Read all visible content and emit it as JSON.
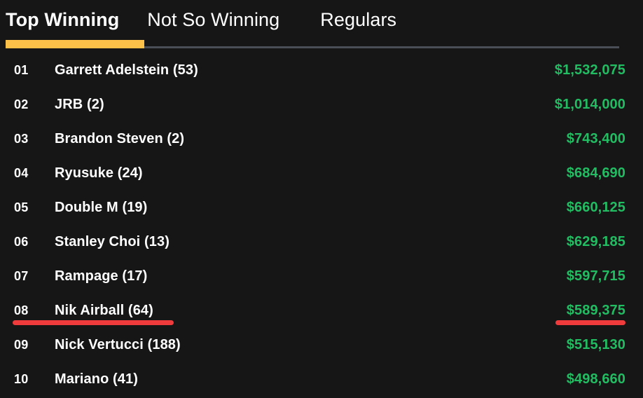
{
  "colors": {
    "background": "#161616",
    "accent_yellow": "#fcc148",
    "amount_green": "#22bd63",
    "annotation_red": "#ef3b3b",
    "track_gray": "#4a4f57",
    "text_white": "#ffffff"
  },
  "tabs": [
    {
      "label": "Top Winning",
      "active": true
    },
    {
      "label": "Not So Winning",
      "active": false
    },
    {
      "label": "Regulars",
      "active": false
    }
  ],
  "leaderboard": {
    "rows": [
      {
        "rank": "01",
        "name": "Garrett Adelstein (53)",
        "amount": "$1,532,075"
      },
      {
        "rank": "02",
        "name": "JRB (2)",
        "amount": "$1,014,000"
      },
      {
        "rank": "03",
        "name": "Brandon Steven (2)",
        "amount": "$743,400"
      },
      {
        "rank": "04",
        "name": "Ryusuke (24)",
        "amount": "$684,690"
      },
      {
        "rank": "05",
        "name": "Double M (19)",
        "amount": "$660,125"
      },
      {
        "rank": "06",
        "name": "Stanley Choi (13)",
        "amount": "$629,185"
      },
      {
        "rank": "07",
        "name": "Rampage (17)",
        "amount": "$597,715"
      },
      {
        "rank": "08",
        "name": "Nik Airball (64)",
        "amount": "$589,375"
      },
      {
        "rank": "09",
        "name": "Nick Vertucci (188)",
        "amount": "$515,130"
      },
      {
        "rank": "10",
        "name": "Mariano (41)",
        "amount": "$498,660"
      }
    ]
  },
  "annotations": [
    {
      "target": "row-08-name",
      "shape": "underline",
      "color": "#ef3b3b"
    },
    {
      "target": "row-08-amount",
      "shape": "underline",
      "color": "#ef3b3b"
    }
  ]
}
